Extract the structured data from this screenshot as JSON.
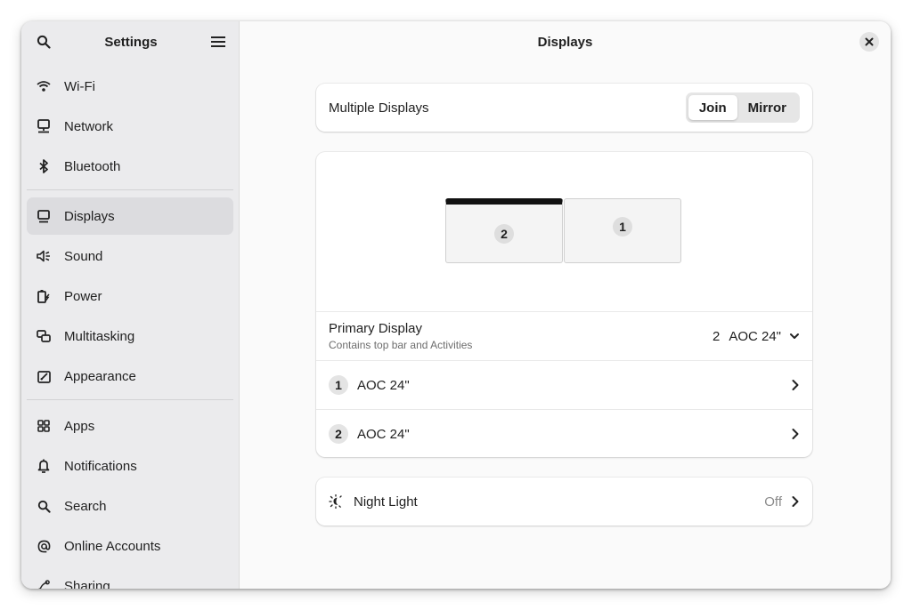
{
  "sidebar": {
    "title": "Settings",
    "items": [
      {
        "label": "Wi-Fi",
        "icon": "wifi-icon"
      },
      {
        "label": "Network",
        "icon": "network-icon"
      },
      {
        "label": "Bluetooth",
        "icon": "bluetooth-icon"
      },
      {
        "label": "Displays",
        "icon": "display-icon",
        "active": true
      },
      {
        "label": "Sound",
        "icon": "speaker-icon"
      },
      {
        "label": "Power",
        "icon": "power-icon"
      },
      {
        "label": "Multitasking",
        "icon": "multitasking-icon"
      },
      {
        "label": "Appearance",
        "icon": "appearance-icon"
      },
      {
        "label": "Apps",
        "icon": "apps-icon"
      },
      {
        "label": "Notifications",
        "icon": "bell-icon"
      },
      {
        "label": "Search",
        "icon": "search-icon"
      },
      {
        "label": "Online Accounts",
        "icon": "at-icon"
      },
      {
        "label": "Sharing",
        "icon": "share-icon"
      }
    ]
  },
  "main": {
    "title": "Displays",
    "multiple_displays": {
      "label": "Multiple Displays",
      "options": [
        "Join",
        "Mirror"
      ],
      "selected": "Join"
    },
    "arrangement": {
      "monitors": [
        {
          "number": "2",
          "primary": true
        },
        {
          "number": "1",
          "primary": false
        }
      ]
    },
    "primary_display": {
      "label": "Primary Display",
      "subtitle": "Contains top bar and Activities",
      "value_number": "2",
      "value_name": "AOC 24\""
    },
    "displays": [
      {
        "number": "1",
        "name": "AOC 24\""
      },
      {
        "number": "2",
        "name": "AOC 24\""
      }
    ],
    "night_light": {
      "label": "Night Light",
      "status": "Off"
    }
  },
  "colors": {
    "sidebar_bg": "#ebebed",
    "active_item": "#dcdcdf",
    "card_bg": "#ffffff",
    "window_bg": "#fafafa"
  }
}
